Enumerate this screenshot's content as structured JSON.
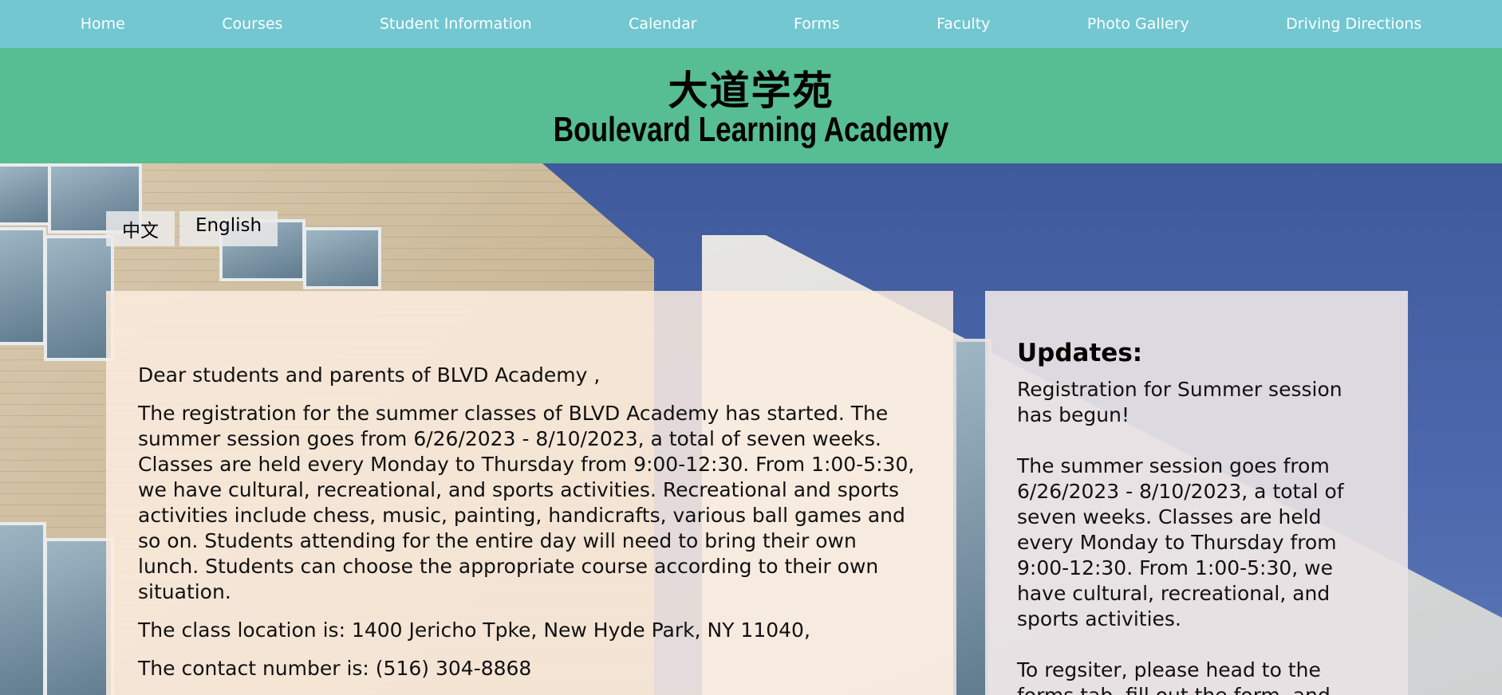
{
  "nav": {
    "items": [
      {
        "label": "Home"
      },
      {
        "label": "Courses"
      },
      {
        "label": "Student Information"
      },
      {
        "label": "Calendar"
      },
      {
        "label": "Forms"
      },
      {
        "label": "Faculty"
      },
      {
        "label": "Photo Gallery"
      },
      {
        "label": "Driving Directions"
      }
    ]
  },
  "header": {
    "title_cn": "大道学苑",
    "title_en": "Boulevard Learning Academy"
  },
  "lang_toggle": {
    "chinese_label": "中文",
    "english_label": "English"
  },
  "main": {
    "paragraphs": [
      "Dear students and parents of BLVD Academy ,",
      "The registration for the summer classes of BLVD Academy has started. The summer session goes from 6/26/2023 - 8/10/2023, a total of seven weeks. Classes are held every Monday to Thursday from 9:00-12:30. From 1:00-5:30, we have cultural, recreational, and sports activities. Recreational and sports activities include chess, music, painting, handicrafts, various ball games and so on. Students attending for the entire day will need to bring their own lunch. Students can choose the appropriate course according to their own situation.",
      "The class location is: 1400 Jericho Tpke, New Hyde Park, NY 11040,",
      "The contact number is: (516) 304-8868"
    ]
  },
  "updates": {
    "title": "Updates:",
    "paragraphs": [
      "Registration for Summer session has begun!",
      "The summer session goes from 6/26/2023 - 8/10/2023, a total of seven weeks. Classes are held every Monday to Thursday from 9:00-12:30. From 1:00-5:30, we have cultural, recreational, and sports activities.",
      "To regsiter, please head to the forms tab, fill out the form, and"
    ]
  },
  "colors": {
    "nav_bg": "#72c7d1",
    "header_bg": "#57bd92",
    "sky": "#4a63a8"
  }
}
